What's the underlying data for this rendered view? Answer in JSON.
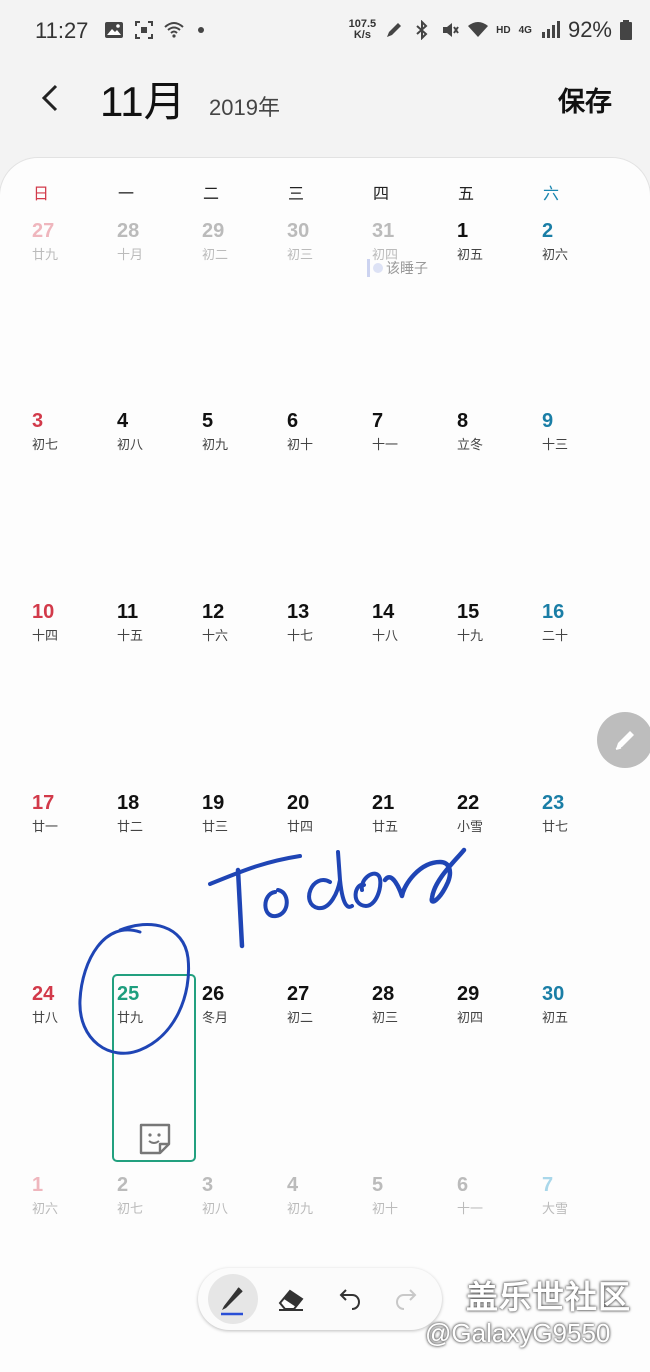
{
  "status_bar": {
    "time": "11:27",
    "net_speed_value": "107.5",
    "net_speed_unit": "K/s",
    "hd": "HD",
    "net_type": "4G",
    "battery": "92%"
  },
  "header": {
    "month": "11月",
    "year": "2019年",
    "save_label": "保存"
  },
  "weekdays": [
    "日",
    "一",
    "二",
    "三",
    "四",
    "五",
    "六"
  ],
  "weeks": [
    [
      {
        "num": "27",
        "lunar": "廿九",
        "dim": true
      },
      {
        "num": "28",
        "lunar": "十月",
        "dim": true
      },
      {
        "num": "29",
        "lunar": "初二",
        "dim": true
      },
      {
        "num": "30",
        "lunar": "初三",
        "dim": true
      },
      {
        "num": "31",
        "lunar": "初四",
        "dim": true
      },
      {
        "num": "1",
        "lunar": "初五"
      },
      {
        "num": "2",
        "lunar": "初六"
      }
    ],
    [
      {
        "num": "3",
        "lunar": "初七"
      },
      {
        "num": "4",
        "lunar": "初八"
      },
      {
        "num": "5",
        "lunar": "初九"
      },
      {
        "num": "6",
        "lunar": "初十"
      },
      {
        "num": "7",
        "lunar": "十一"
      },
      {
        "num": "8",
        "lunar": "立冬"
      },
      {
        "num": "9",
        "lunar": "十三"
      }
    ],
    [
      {
        "num": "10",
        "lunar": "十四"
      },
      {
        "num": "11",
        "lunar": "十五"
      },
      {
        "num": "12",
        "lunar": "十六"
      },
      {
        "num": "13",
        "lunar": "十七"
      },
      {
        "num": "14",
        "lunar": "十八"
      },
      {
        "num": "15",
        "lunar": "十九"
      },
      {
        "num": "16",
        "lunar": "二十"
      }
    ],
    [
      {
        "num": "17",
        "lunar": "廿一"
      },
      {
        "num": "18",
        "lunar": "廿二"
      },
      {
        "num": "19",
        "lunar": "廿三"
      },
      {
        "num": "20",
        "lunar": "廿四"
      },
      {
        "num": "21",
        "lunar": "廿五"
      },
      {
        "num": "22",
        "lunar": "小雪"
      },
      {
        "num": "23",
        "lunar": "廿七"
      }
    ],
    [
      {
        "num": "24",
        "lunar": "廿八"
      },
      {
        "num": "25",
        "lunar": "廿九",
        "today": true
      },
      {
        "num": "26",
        "lunar": "冬月"
      },
      {
        "num": "27",
        "lunar": "初二"
      },
      {
        "num": "28",
        "lunar": "初三"
      },
      {
        "num": "29",
        "lunar": "初四"
      },
      {
        "num": "30",
        "lunar": "初五"
      }
    ],
    [
      {
        "num": "1",
        "lunar": "初六",
        "dim": true
      },
      {
        "num": "2",
        "lunar": "初七",
        "dim": true
      },
      {
        "num": "3",
        "lunar": "初八",
        "dim": true
      },
      {
        "num": "4",
        "lunar": "初九",
        "dim": true
      },
      {
        "num": "5",
        "lunar": "初十",
        "dim": true
      },
      {
        "num": "6",
        "lunar": "十一",
        "dim": true
      },
      {
        "num": "7",
        "lunar": "大雪",
        "dim": true
      }
    ]
  ],
  "event": {
    "title": "该睡子"
  },
  "handwriting": {
    "text": "Today",
    "color": "#1f45b5"
  },
  "colors": {
    "sunday": "#d23a4a",
    "saturday": "#1a7ea6",
    "today": "#1e9e7e",
    "accent_pen": "#1f45b5"
  },
  "toolbar": {
    "icons": [
      "pen-icon",
      "eraser-icon",
      "undo-icon",
      "redo-icon"
    ]
  },
  "watermark": {
    "line1": "盖乐世社区",
    "line2": "@GalaxyG9550"
  }
}
